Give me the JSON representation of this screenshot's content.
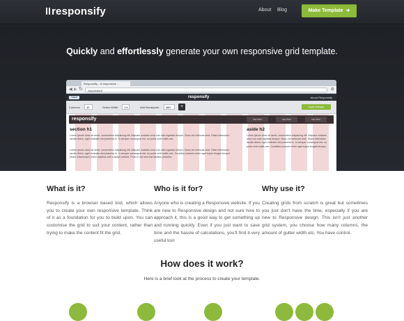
{
  "header": {
    "logo": "responsify",
    "nav": [
      "About",
      "Blog"
    ],
    "cta": "Make Template"
  },
  "hero": {
    "headline_part1": "Quickly",
    "headline_part2": " and ",
    "headline_part3": "effortlessly",
    "headline_part4": " generate your own responsive grid template."
  },
  "browser": {
    "tab_title": "Responsify – A responsive ...",
    "url": "responsify.it",
    "app_logo": "responsify",
    "tweet": "Tweet",
    "about": "About Responsify",
    "controls": {
      "columns_label": "Columns",
      "columns_value": "12",
      "gutter_label": "Gutter Width",
      "gutter_value": "1.5",
      "breakpoint_label": "Add Breakpoint",
      "breakpoint_value": "480",
      "plus": "+",
      "apply": "Apply changes"
    },
    "preview": {
      "logo": "responsify",
      "nav": [
        "nav item",
        "nav item",
        "nav item"
      ],
      "section_heading": "section h1",
      "aside_heading": "aside h2",
      "para1": "Lorem ipsum dolor sit amet, consectetur adipiscing elit. Aliquam sodales urna non odio egestas tempor. Nunc vel vehicula ante. Etiam bibendum iaculis libero, eget molestie nisl pharetra in. In semper consequat est, eu porta velit mollis nec.",
      "para2": "Lorem ipsum dolor sit amet, consectetur adipiscing elit. Aliquam sodales urna non odio egestas tempor. Nunc vel vehicula ante. Etiam bibendum iaculis libero, eget molestie nisl pharetra in. In semper consequat est, eu porta velit mollis nec. Curabitur posuere enim eget turpis feugiat tempor. Etiam ullamcorper lorem dapibus velit suscipit ultrices. Proin in est sed erat facilisis pharetra.",
      "aside_para": "Lorem ipsum dolor sit amet, consectetur adipiscing elit. Aliquam sodales urna non odio egestas tempor. Nunc vel vehicula ante. Etiam bibendum iaculis libero, eget molestie nisl pharetra in. In semper consequat est, eu porta velit mollis nec. Curabitur posuere enim eget turpis feugiat tempor."
    }
  },
  "features": [
    {
      "title": "What is it?",
      "body": "Responsify is a browser based tool, which allows you to create your own responsive template. Think of it as a foundation for you to build upon. You can customise the grid to suit your content, rather than trying to make the content fit the grid."
    },
    {
      "title": "Who is it for?",
      "body": "Anyone who is creating a Responsive website. If you are new to Responsive design and not sure how to approach it, this is a good way to get something up and running quickly. Even if you just want to save time and the hassle of calculations, you'll find it very useful too!"
    },
    {
      "title": "Why use it?",
      "body": "Creating grids from scratch is great but sometimes you just don't have the time, especially if you are new to Responsive design. This isn't just another grid system, you choose how many columns, the amount of gutter width etc. You have control."
    }
  ],
  "how": {
    "title": "How does it work?",
    "subtitle": "Here is a brief look at the process to create your template."
  },
  "colors": {
    "accent": "#8dba3b",
    "dark": "#25282e",
    "grid_column": "#f1d7d8"
  }
}
